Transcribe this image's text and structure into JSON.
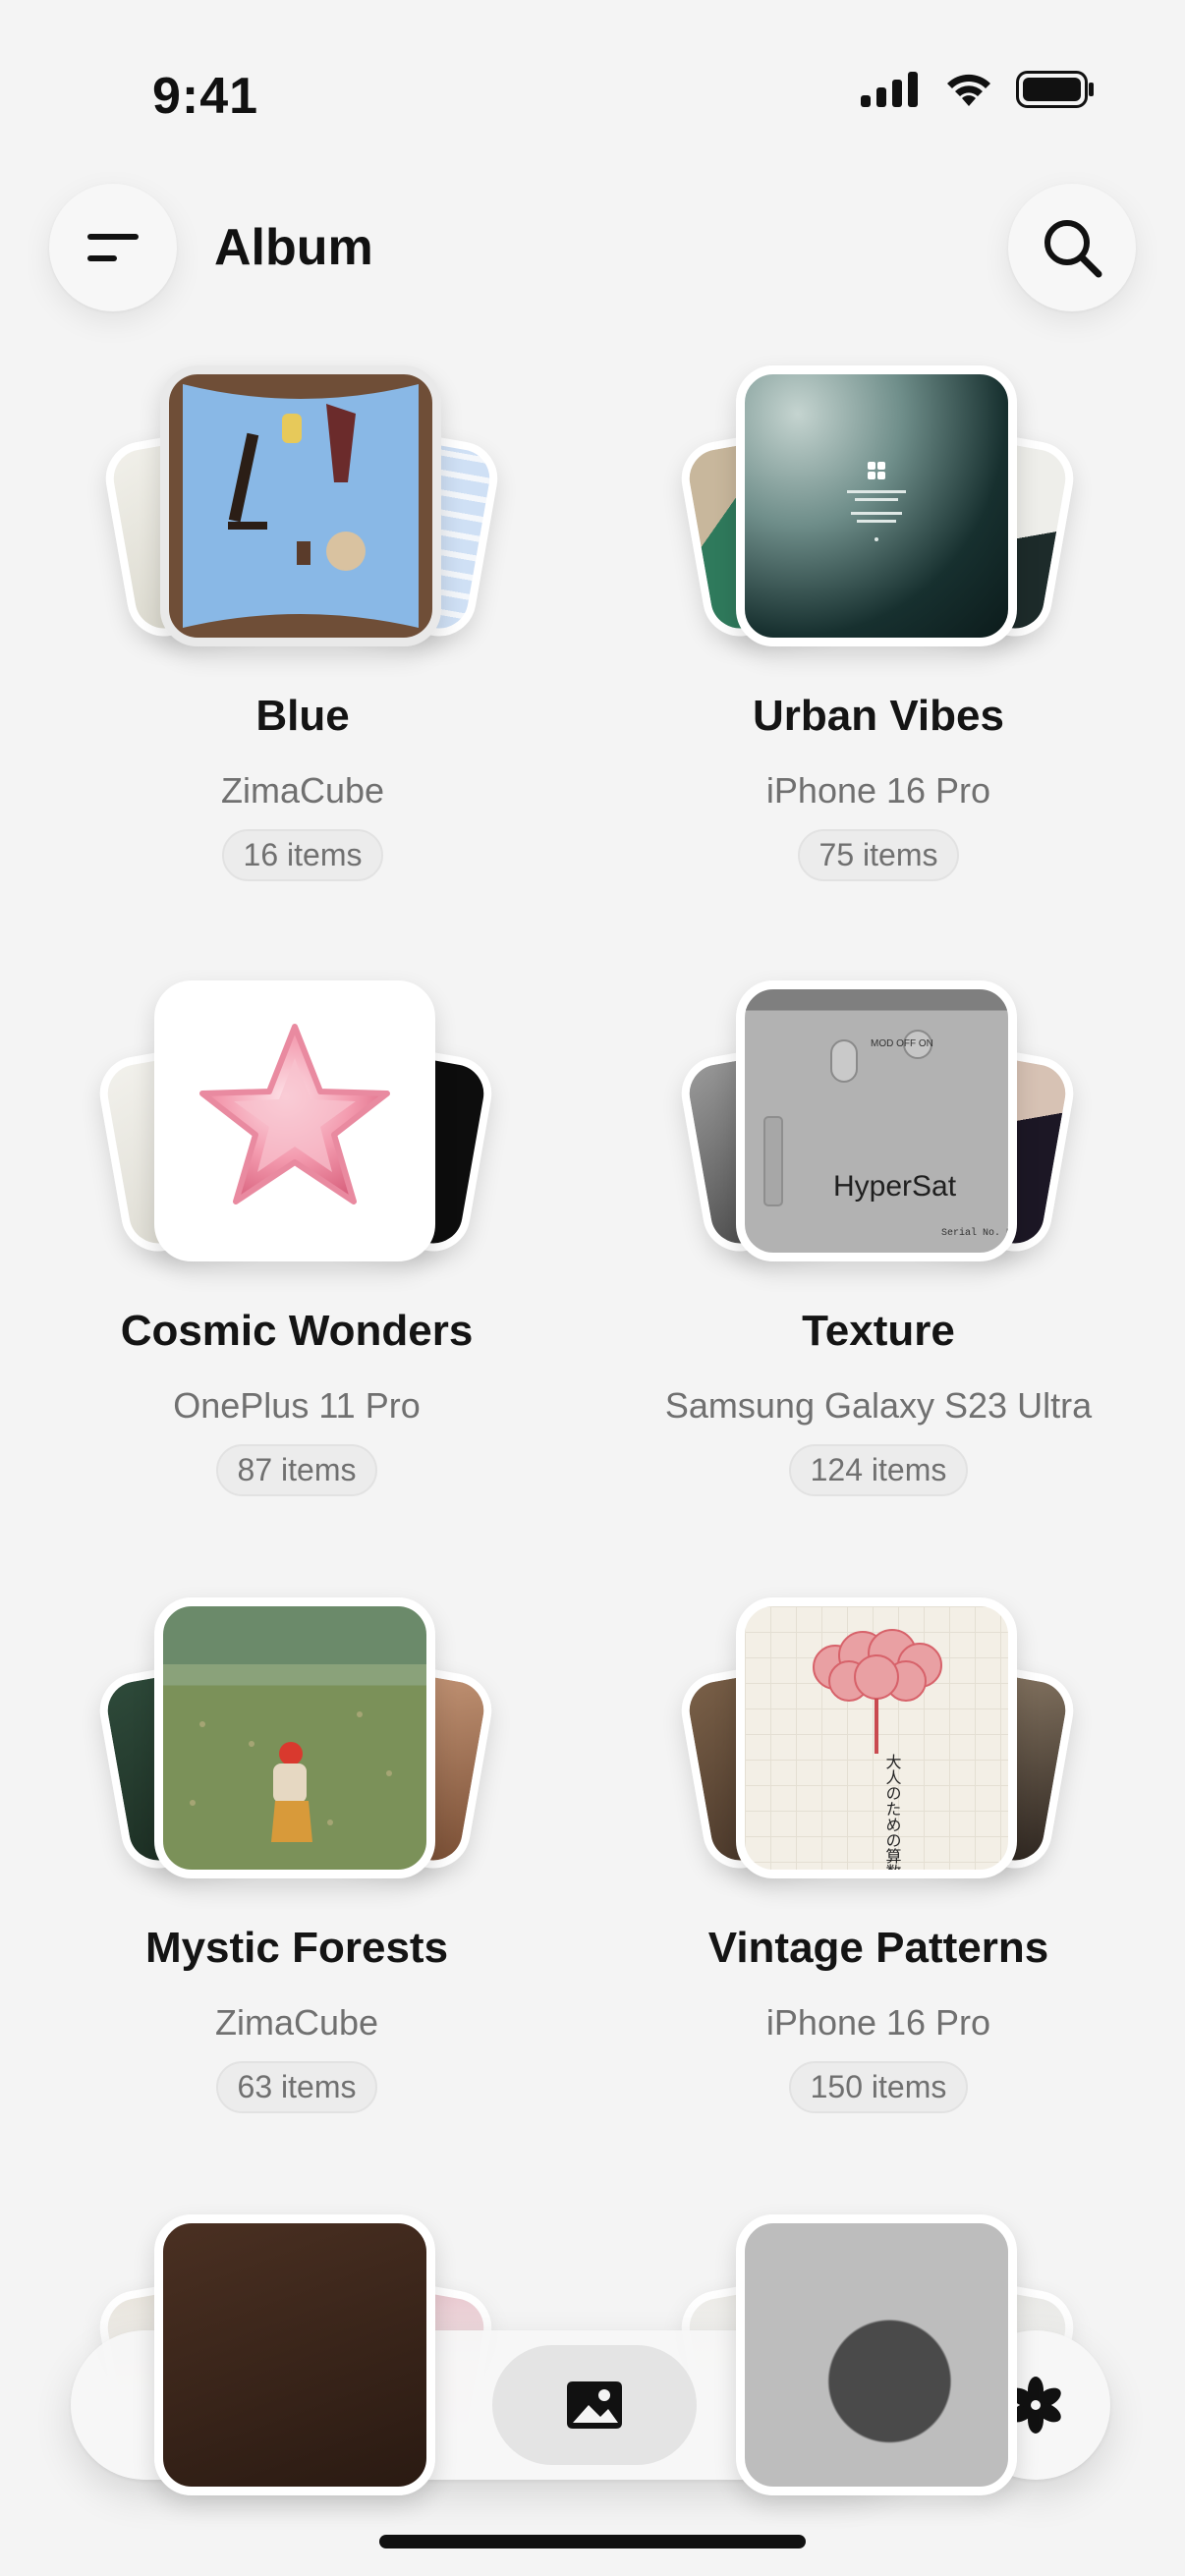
{
  "status_bar": {
    "time": "9:41"
  },
  "header": {
    "title": "Album"
  },
  "albums": [
    {
      "name": "Blue",
      "device": "ZimaCube",
      "count": "16 items"
    },
    {
      "name": "Urban Vibes",
      "device": "iPhone 16 Pro",
      "count": "75 items"
    },
    {
      "name": "Cosmic Wonders",
      "device": "OnePlus 11 Pro",
      "count": "87 items"
    },
    {
      "name": "Texture",
      "device": "Samsung Galaxy S23 Ultra",
      "count": "124 items"
    },
    {
      "name": "Mystic Forests",
      "device": "ZimaCube",
      "count": "63 items"
    },
    {
      "name": "Vintage Patterns",
      "device": "iPhone 16 Pro",
      "count": "150 items"
    }
  ],
  "thumbnails": {
    "hypersat_text": "HyperSat",
    "hypersat_serial": "Serial No. HyperLens",
    "hypersat_mode": "MOD OFF ON",
    "vintage_title": "大人のための算数"
  },
  "nav": {
    "items": [
      "zima-logo-icon",
      "files-icon",
      "photos-icon",
      "apps-grid-icon"
    ],
    "active": "photos-icon",
    "fab_icon": "flower-icon"
  },
  "colors": {
    "background": "#f4f4f4",
    "text": "#141414",
    "muted": "#707070",
    "badge_dot": "#2ecc71"
  }
}
